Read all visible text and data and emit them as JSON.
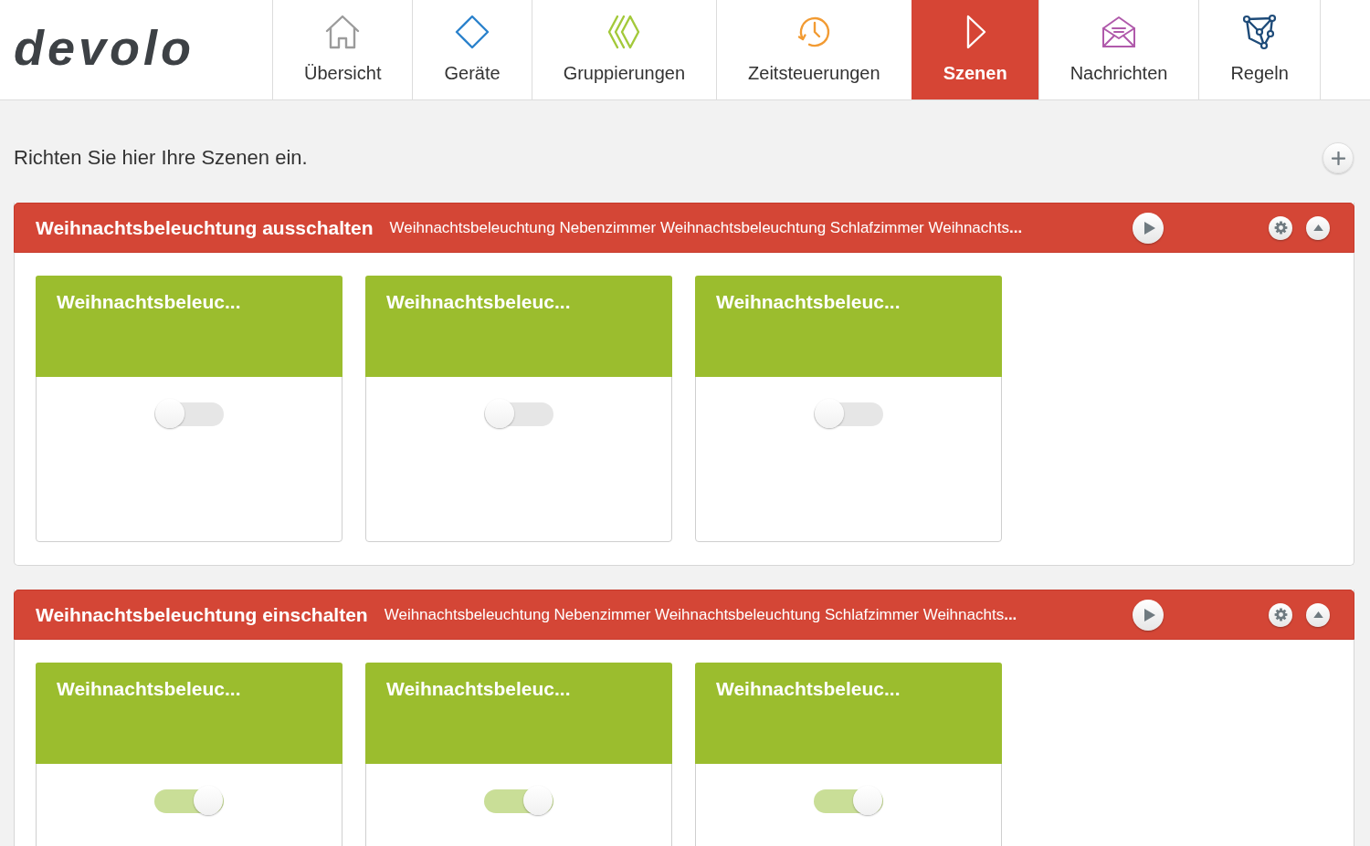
{
  "header": {
    "logo": "devolo",
    "tabs": [
      {
        "label": "Übersicht",
        "selected": false
      },
      {
        "label": "Geräte",
        "selected": false
      },
      {
        "label": "Gruppierungen",
        "selected": false
      },
      {
        "label": "Zeitsteuerungen",
        "selected": false
      },
      {
        "label": "Szenen",
        "selected": true
      },
      {
        "label": "Nachrichten",
        "selected": false
      },
      {
        "label": "Regeln",
        "selected": false
      }
    ]
  },
  "intro": "Richten Sie hier Ihre Szenen ein.",
  "scenes": [
    {
      "title": "Weihnachtsbeleuchtung ausschalten",
      "devices": "Weihnachtsbeleuchtung Nebenzimmer Weihnachtsbeleuchtung Schlafzimmer Weihnachts**...**",
      "expanded": true,
      "cards": [
        {
          "title": "Weihnachtsbeleuc...",
          "on": false
        },
        {
          "title": "Weihnachtsbeleuc...",
          "on": false
        },
        {
          "title": "Weihnachtsbeleuc...",
          "on": false
        }
      ]
    },
    {
      "title": "Weihnachtsbeleuchtung einschalten",
      "devices": "Weihnachtsbeleuchtung Nebenzimmer Weihnachtsbeleuchtung Schlafzimmer Weihnachts**...**",
      "expanded": true,
      "cards": [
        {
          "title": "Weihnachtsbeleuc...",
          "on": true
        },
        {
          "title": "Weihnachtsbeleuc...",
          "on": true
        },
        {
          "title": "Weihnachtsbeleuc...",
          "on": true
        }
      ]
    }
  ]
}
